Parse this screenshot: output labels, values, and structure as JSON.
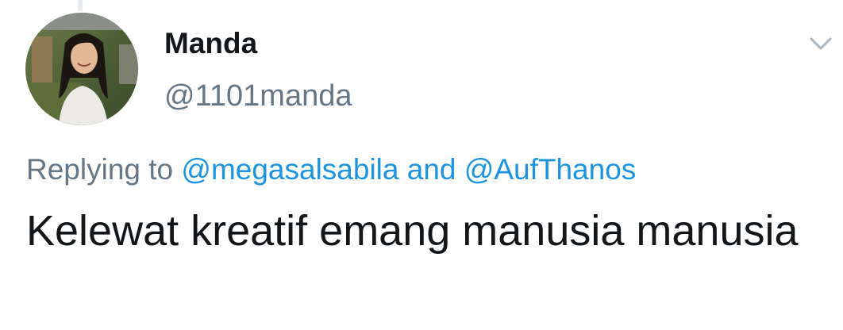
{
  "tweet": {
    "author": {
      "display_name": "Manda",
      "handle": "@1101manda",
      "avatar": "profile-photo"
    },
    "replying_prefix": "Replying to",
    "replying_to": [
      "@megasalsabila",
      "@AufThanos"
    ],
    "replying_joiner": "and",
    "text": "Kelewat kreatif emang manusia manusia",
    "menu_icon": "chevron-down-icon"
  },
  "colors": {
    "text_primary": "#14171a",
    "text_secondary": "#657786",
    "link": "#1b95e0",
    "icon": "#aab8c2"
  }
}
